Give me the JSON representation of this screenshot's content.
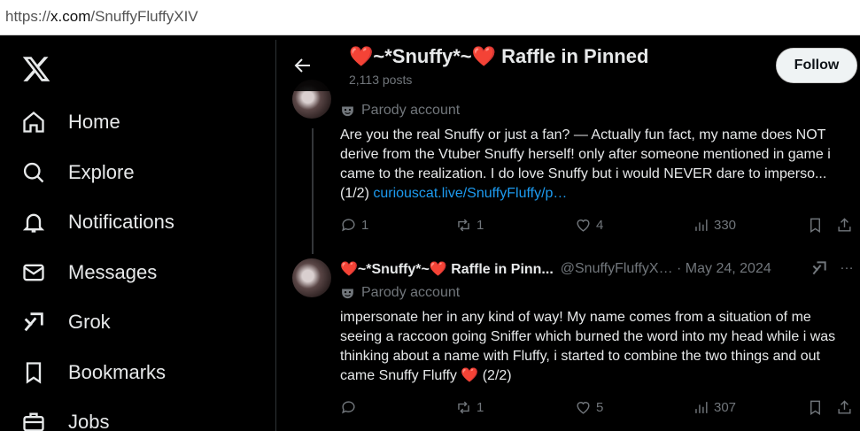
{
  "browser": {
    "url_prefix": "https://",
    "url_domain": "x.com",
    "url_path": "/SnuffyFluffyXIV"
  },
  "sidebar": {
    "items": [
      {
        "label": "Home",
        "icon": "home-icon"
      },
      {
        "label": "Explore",
        "icon": "search-icon"
      },
      {
        "label": "Notifications",
        "icon": "bell-icon"
      },
      {
        "label": "Messages",
        "icon": "mail-icon"
      },
      {
        "label": "Grok",
        "icon": "grok-icon"
      },
      {
        "label": "Bookmarks",
        "icon": "bookmark-icon"
      },
      {
        "label": "Jobs",
        "icon": "briefcase-icon"
      }
    ]
  },
  "header": {
    "title_prefix": "❤️~*Snuffy*~❤️",
    "title_suffix": " Raffle in Pinned",
    "posts": "2,113 posts",
    "follow_label": "Follow"
  },
  "tweets": [
    {
      "label": "Parody account",
      "text_plain": "Are you the real Snuffy or just a fan? — Actually fun fact, my name does NOT derive from the Vtuber Snuffy herself! only after someone mentioned in game i came to the realization. I do love Snuffy but i would NEVER dare to imperso... (1/2) ",
      "link": "curiouscat.live/SnuffyFluffy/p…",
      "replies": "1",
      "reposts": "1",
      "likes": "4",
      "views": "330"
    },
    {
      "name": "❤️~*Snuffy*~❤️ Raffle in Pinn...",
      "meta": "@SnuffyFluffyX… · May 24, 2024",
      "label": "Parody account",
      "text_plain": "impersonate her in any kind of way! My name comes from a situation of me seeing a raccoon going Sniffer which burned the word into my head while i was thinking about a name with Fluffy, i started to combine the two things and out came Snuffy Fluffy ",
      "text_end": "❤️ (2/2)",
      "replies": "",
      "reposts": "1",
      "likes": "5",
      "views": "307"
    }
  ],
  "colors": {
    "accent": "#1d9bf0",
    "muted": "#71767b",
    "text": "#e7e9ea",
    "heart": "#e0245e"
  }
}
